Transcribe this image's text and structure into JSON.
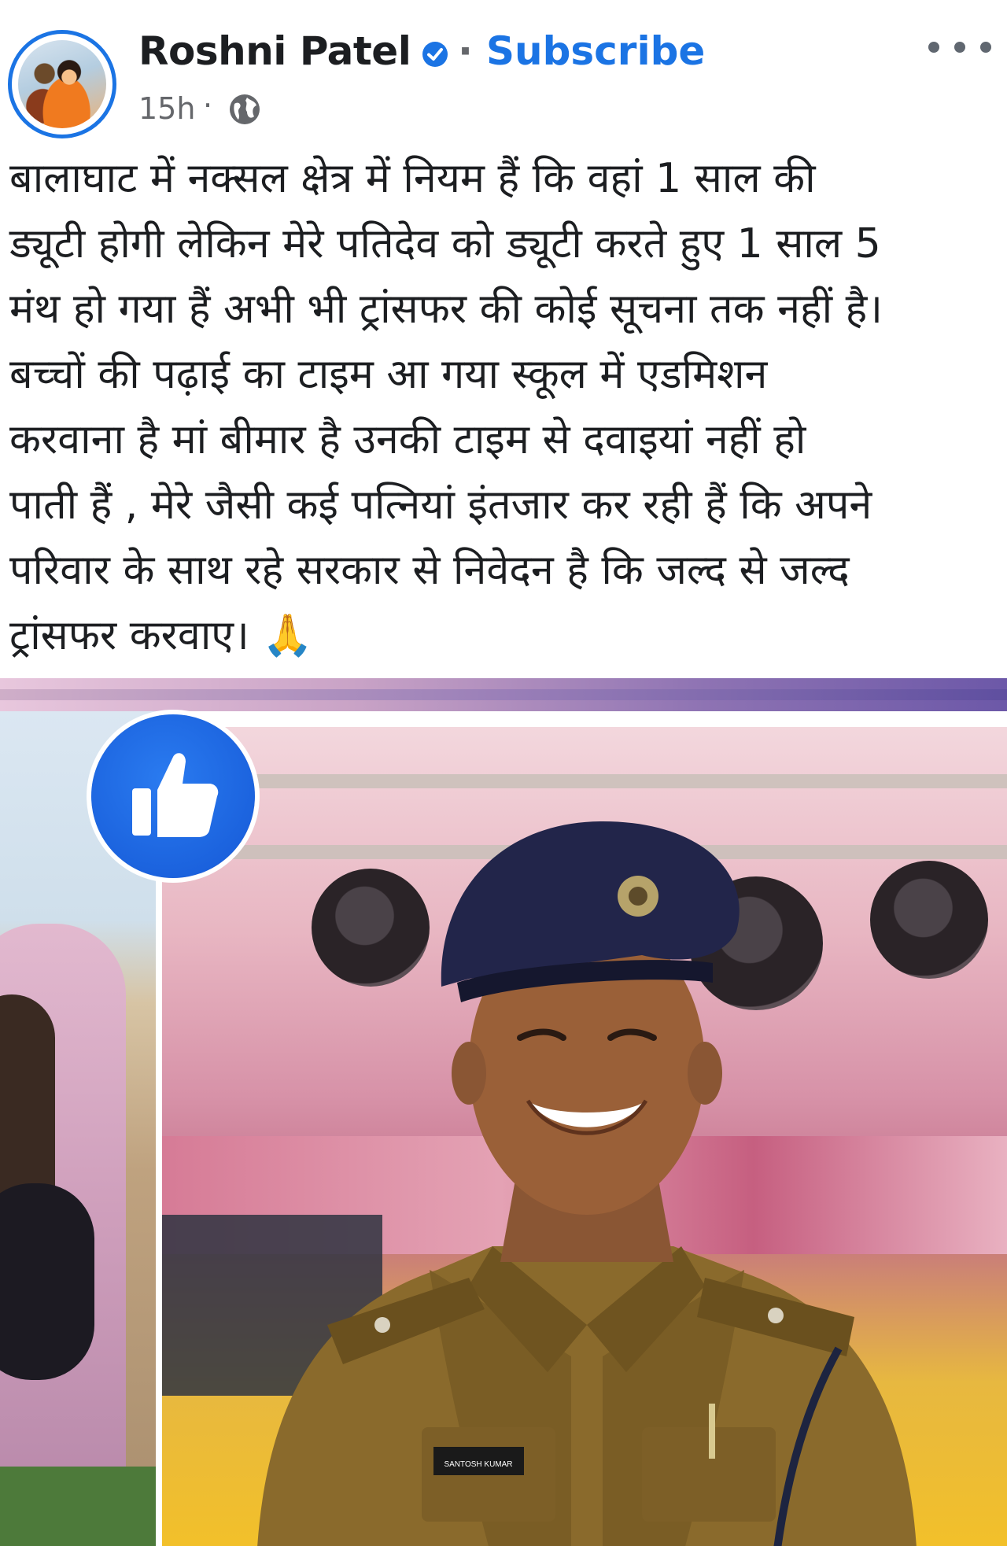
{
  "post": {
    "author": "Roshni Patel",
    "separator": "·",
    "subscribe_label": "Subscribe",
    "time": "15h",
    "time_separator": "·",
    "audience_icon": "globe-icon",
    "menu_icon": "more-options-icon",
    "verified_icon": "verified-badge-icon",
    "text_lines": [
      "बालाघाट में नक्सल क्षेत्र में नियम हैं कि वहां 1 साल की",
      "ड्यूटी होगी लेकिन मेरे पतिदेव को ड्यूटी करते हुए 1 साल 5",
      "मंथ हो गया हैं अभी भी ट्रांसफर की कोई सूचना तक नहीं है।",
      "बच्चों की पढ़ाई का टाइम आ गया स्कूल में एडमिशन",
      "करवाना है  मां बीमार है उनकी टाइम से दवाइयां नहीं हो",
      "पाती हैं , मेरे जैसी कई पत्नियां इंतजार कर रही हैं कि अपने",
      "परिवार के साथ रहे सरकार से निवेदन है कि जल्द से जल्द",
      "ट्रांसफर करवाए। 🙏"
    ],
    "reaction_icon": "like-thumbs-up-icon",
    "name_plate": "SANTOSH KUMAR"
  },
  "colors": {
    "brand_blue": "#1b74e4",
    "text": "#1c1e21",
    "meta": "#65676b",
    "uniform_khaki": "#8a6a2c",
    "beret_navy": "#22254a"
  }
}
